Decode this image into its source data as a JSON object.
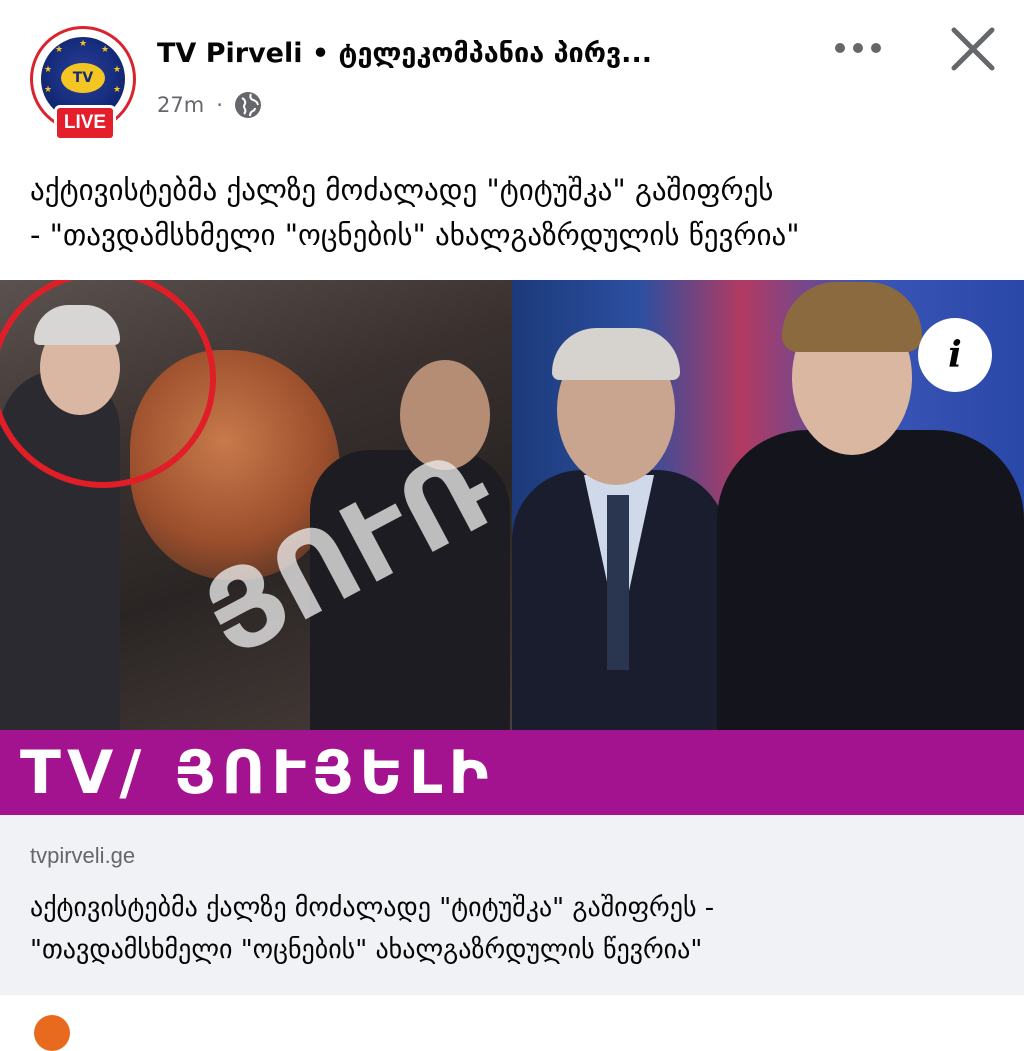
{
  "header": {
    "page_name": "TV Pirveli • ტელეკომპანია პირვ...",
    "time": "27m",
    "separator": "·",
    "audience_icon": "globe-icon",
    "live_badge": "LIVE",
    "avatar_logo_text": "TV"
  },
  "post": {
    "text_line1": "აქტივისტებმა ქალზე მოძალადე \"ტიტუშკა\" გაშიფრეს",
    "text_line2": "- \"თავდამსხმელი \"ოცნების\" ახალგაზრდულის წევრია\""
  },
  "image": {
    "watermark": "ՅՈՒՌ",
    "brand_strip_text": "TV/ ՅՈՒՅԵԼԻ",
    "brand_color": "#a4138f",
    "info_icon_label": "i"
  },
  "link_preview": {
    "domain": "tvpirveli.ge",
    "title_line1": "აქტივისტებმა ქალზე მოძალადე \"ტიტუშკა\" გაშიფრეს -",
    "title_line2": "\"თავდამსხმელი \"ოცნების\" ახალგაზრდულის წევრია\""
  },
  "icons": [
    "more-options-icon",
    "close-icon",
    "globe-icon",
    "info-icon"
  ]
}
